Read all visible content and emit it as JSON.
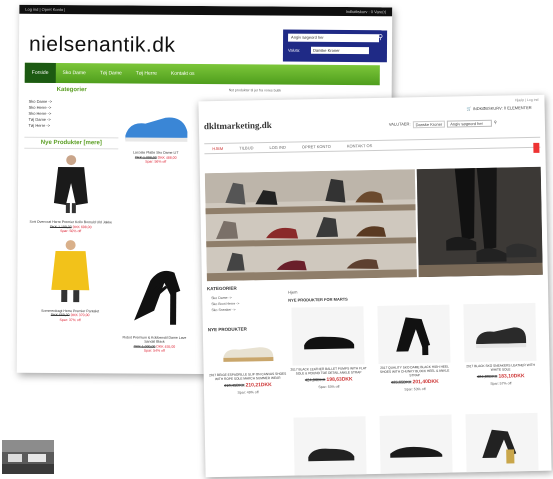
{
  "site1": {
    "topbar": {
      "left": "Log ind | Opret Konto |",
      "right": "Indkøbskurv : 0 Vare(r)"
    },
    "logo": "nielsenantik.dk",
    "search": {
      "placeholder": "Angiv søgeord her"
    },
    "valuta": {
      "label": "Valuta:",
      "selected": "Danske Kroner"
    },
    "nav": [
      "Forside",
      "Sko Dame",
      "Tøj Dame",
      "Tøj Herre",
      "Kontakt os"
    ],
    "sidebar": {
      "heading": "Kategorier",
      "links": [
        "Sko Dame ->",
        "Sko Herre ->",
        "Sko Herre ->",
        "Tøj Dame ->",
        "Tøj Herre ->"
      ],
      "new_heading": "Nye Produkter",
      "new_more": "[mere]"
    },
    "products": [
      {
        "name": "Sort Overcoat Herre Premier Kollo Bomuld Uld Jakke",
        "old": "DKK 1.199,00",
        "price": "DKK 698,00",
        "save": "Spar: 50% off"
      },
      {
        "name": "Sommerdragt Herre Premier Pantalet",
        "old": "DKK 659,00",
        "price": "DKK 370,00",
        "save": "Spar: 37% off"
      },
      {
        "name": "Lacoste Platte Sko Dame LIT",
        "old": "DKK 1.098,00",
        "price": "DKK 488,00",
        "save": "Spar: 56% off"
      },
      {
        "name": "Robot Premium & Kobbenstil Dame Lave Sandal Black",
        "old": "DKK 1.000,00",
        "price": "DKK 455,00",
        "save": "Spar: 54% off"
      }
    ],
    "banner_note": "Nyt produkter til jer fra vores butik"
  },
  "site2": {
    "logo": "dkltmarketing.dk",
    "topright": "Hjælp | Log ind",
    "cart": "INDKØBSKURV: 0 ELEMENTER",
    "valuta": {
      "label": "VALUTAER:",
      "selected": "Danske Kroner"
    },
    "search": {
      "placeholder": "Angiv søgeord her"
    },
    "nav": [
      "HJEM",
      "TILBUD",
      "LOG IND",
      "OPRET KONTO",
      "KONTAKT OS"
    ],
    "side": {
      "heading": "KATEGORIER",
      "links": [
        "Sko Dame ->",
        "Sko Boot Herre ->",
        "Sko Sneaker ->"
      ],
      "new_heading": "NYE PRODUKTER"
    },
    "main": {
      "breadcrumb": "Hjem",
      "heading": "NYE PRODUKTER FOR MARTS",
      "products": [
        {
          "name": "2017 BLACK LEATHER BALLET PUMPS WITH FLAT SOLE & ROUND TOE DETAIL ANKLE STRAP",
          "old": "424,86DKK",
          "price": "198,63DKK",
          "save": "Spar: 53% off"
        },
        {
          "name": "2017 QUALITY SKO DAME BLACK HIGH HEEL SHOES WITH CHUNKY BLOCK HEEL & ANKLE STRAP",
          "old": "425,65DKK",
          "price": "201,40DKK",
          "save": "Spar: 53% off"
        },
        {
          "name": "2017 BLACK SKO SNEAKERS LEATHER WITH WHITE SOLE",
          "old": "424,80DKK",
          "price": "183,10DKK",
          "save": "Spar: 57% off"
        },
        {
          "name": "2017 BEIGE ESPADRILLE SLIP ON CANVAS SHOES WITH ROPE SOLE MARCH SUMMER WEAR",
          "old": "410,45DKK",
          "price": "210,21DKK",
          "save": "Spar: 49% off"
        }
      ]
    }
  },
  "thumb": "small photo thumbnail"
}
